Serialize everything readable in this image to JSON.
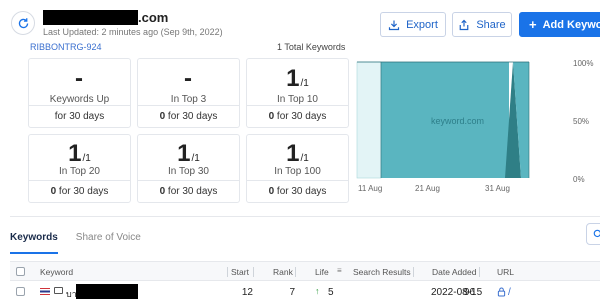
{
  "header": {
    "domain_suffix": ".com",
    "last_updated": "Last Updated: 2 minutes ago (Sep 9th, 2022)",
    "buttons": {
      "export": "Export",
      "share": "Share",
      "add_keywords": "Add Keywords"
    }
  },
  "summary": {
    "tag": "RIBBONTRG-924",
    "total_keywords": "1 Total Keywords"
  },
  "stats": [
    {
      "value": "-",
      "suffix": "",
      "label": "Keywords Up",
      "count": "",
      "period": "for 30 days"
    },
    {
      "value": "-",
      "suffix": "",
      "label": "In Top 3",
      "count": "0",
      "period": "for 30 days"
    },
    {
      "value": "1",
      "suffix": "/1",
      "label": "In Top 10",
      "count": "0",
      "period": "for 30 days"
    },
    {
      "value": "1",
      "suffix": "/1",
      "label": "In Top 20",
      "count": "0",
      "period": "for 30 days"
    },
    {
      "value": "1",
      "suffix": "/1",
      "label": "In Top 30",
      "count": "0",
      "period": "for 30 days"
    },
    {
      "value": "1",
      "suffix": "/1",
      "label": "In Top 100",
      "count": "0",
      "period": "for 30 days"
    }
  ],
  "chart_data": {
    "type": "area",
    "x_ticks": [
      "11 Aug",
      "21 Aug",
      "31 Aug"
    ],
    "y_ticks": [
      "100%",
      "50%",
      "0%"
    ],
    "watermark": "keyword.com",
    "colors": {
      "fill": "#5ab5c0",
      "fill_light": "#e3f4f6",
      "fill_dark": "#2f7f86",
      "line": "#2a6f78"
    }
  },
  "tabs": [
    {
      "label": "Keywords",
      "active": true
    },
    {
      "label": "Share of Voice",
      "active": false
    }
  ],
  "table": {
    "columns": [
      "Keyword",
      "Start",
      "Rank",
      "Life",
      "Search Results",
      "Date Added",
      "URL"
    ],
    "rows": [
      {
        "keyword_prefix": "บา",
        "start": "12",
        "rank": "7",
        "life": "5",
        "search_results": "96",
        "date_added": "2022-08-15",
        "url": "/"
      }
    ]
  },
  "colors": {
    "accent": "#1a73e8",
    "life_up": "#2e9a3c"
  }
}
